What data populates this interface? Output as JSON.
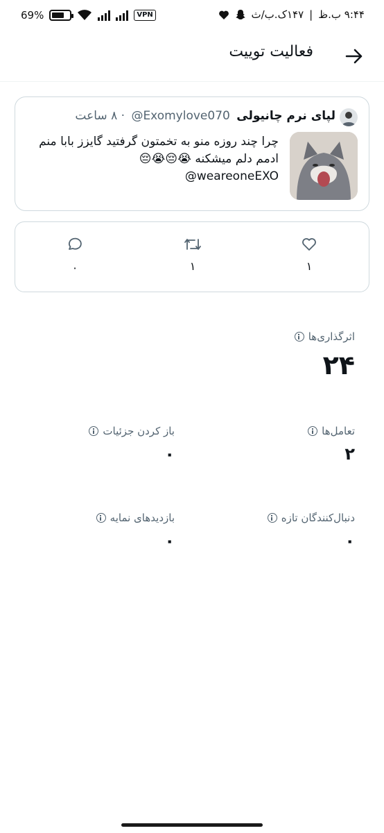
{
  "status_bar": {
    "battery_pct": "69%",
    "battery_level": 0.69,
    "vpn": "VPN",
    "time": "۹:۴۴ ب.ظ",
    "date": "۱۴۷ک.ب/ث"
  },
  "header": {
    "title": "فعالیت توییت"
  },
  "tweet": {
    "name": "لپای نرم چانیولی",
    "handle": "@Exomylove070",
    "time": "· ۸ ساعت",
    "text": "چرا چند روزه منو به تخمتون گرفتید گایزز بابا منم ادمم دلم میشکنه 😭😔😭😔",
    "mention": "@weareoneEXO"
  },
  "actions": {
    "likes": "۱",
    "retweets": "۱",
    "replies": "۰"
  },
  "stats": {
    "impressions_label": "اثرگذاری‌ها",
    "impressions_value": "۲۴",
    "engagements_label": "تعامل‌ها",
    "engagements_value": "۲",
    "detail_expands_label": "باز کردن جزئیات",
    "detail_expands_value": "۰",
    "new_followers_label": "دنبال‌کنندگان تازه",
    "new_followers_value": "۰",
    "profile_visits_label": "بازدیدهای نمایه",
    "profile_visits_value": "۰"
  },
  "icons": {
    "back": "arrow-right-icon",
    "like": "heart-icon",
    "retweet": "retweet-icon",
    "reply": "reply-icon",
    "info": "info-icon"
  }
}
